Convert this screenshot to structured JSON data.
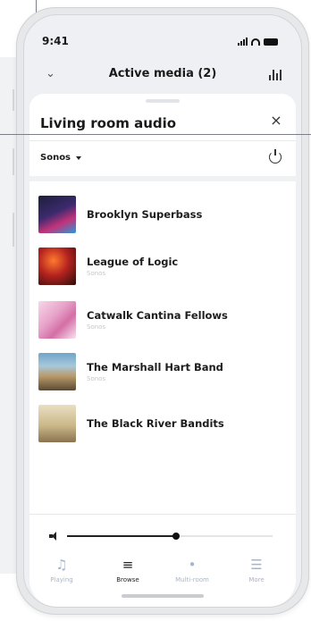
{
  "status_bar": {
    "time": "9:41"
  },
  "header": {
    "title": "Active media (2)"
  },
  "sheet": {
    "title": "Living room audio",
    "source": "Sonos"
  },
  "list": {
    "items": [
      {
        "title": "Brooklyn Superbass",
        "subtitle": ""
      },
      {
        "title": "League of Logic",
        "subtitle": "Sonos"
      },
      {
        "title": "Catwalk Cantina Fellows",
        "subtitle": "Sonos"
      },
      {
        "title": "The Marshall Hart Band",
        "subtitle": "Sonos"
      },
      {
        "title": "The Black River Bandits",
        "subtitle": ""
      }
    ]
  },
  "volume": {
    "level": 0.53
  },
  "tabs": [
    {
      "label": "Playing",
      "icon": "music-note-icon",
      "active": false
    },
    {
      "label": "Browse",
      "icon": "playlist-icon",
      "active": true
    },
    {
      "label": "Multi-room",
      "icon": "broadcast-icon",
      "active": false
    },
    {
      "label": "More",
      "icon": "menu-icon",
      "active": false
    }
  ]
}
